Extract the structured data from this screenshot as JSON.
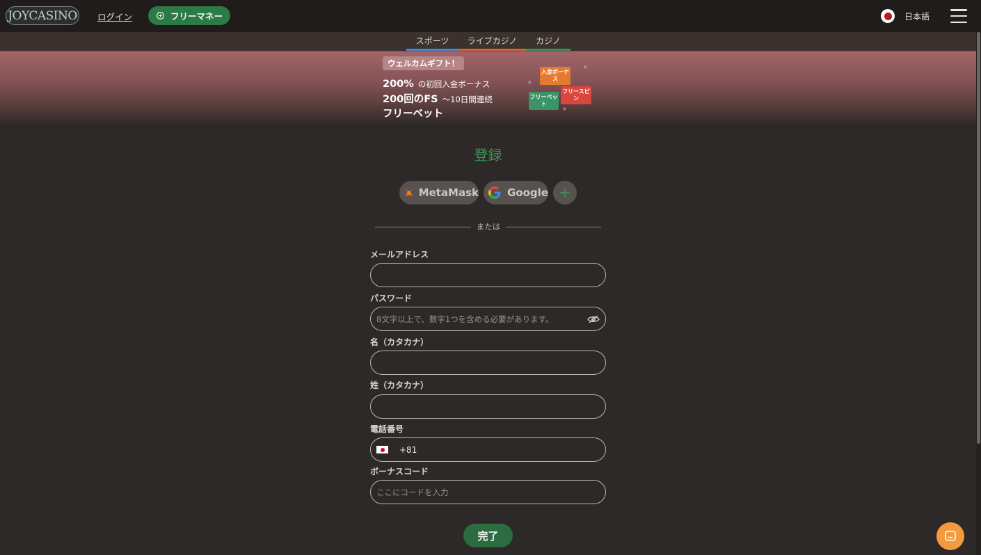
{
  "header": {
    "logo_text": "JOYCASINO",
    "login_label": "ログイン",
    "free_money_label": "フリーマネー",
    "language_label": "日本語"
  },
  "nav_tabs": [
    {
      "label": "スポーツ",
      "color": "#4d82c7"
    },
    {
      "label": "ライブカジノ",
      "color": "#d6603b"
    },
    {
      "label": "カジノ",
      "color": "#3f8a52"
    }
  ],
  "promo": {
    "chip": "ウェルカムギフト！",
    "line1_big": "200%",
    "line1_small": "の初回入金ボーナス",
    "line2_big": "200回のFS",
    "line2_small": "～10日間連続",
    "line3": "フリーベット",
    "tags": {
      "deposit_bonus": "入金ボーナス",
      "free_bet": "フリーベット",
      "free_spin": "フリースピン"
    }
  },
  "form": {
    "title": "登録",
    "social": {
      "metamask": "MetaMask",
      "google": "Google",
      "more": "+"
    },
    "divider": "または",
    "email_label": "メールアドレス",
    "email_value": "",
    "password_label": "パスワード",
    "password_placeholder": "8文字以上で、数字1つを含める必要があります。",
    "first_name_label": "名（カタカナ）",
    "first_name_value": "",
    "last_name_label": "姓（カタカナ）",
    "last_name_value": "",
    "phone_label": "電話番号",
    "phone_code": "+81",
    "phone_value": "",
    "bonus_label": "ボーナスコード",
    "bonus_placeholder": "ここにコードを入力",
    "submit": "完了"
  },
  "colors": {
    "accent_green": "#2c7a45",
    "title_green": "#3d9a58",
    "chat_orange": "#f39a3d"
  }
}
